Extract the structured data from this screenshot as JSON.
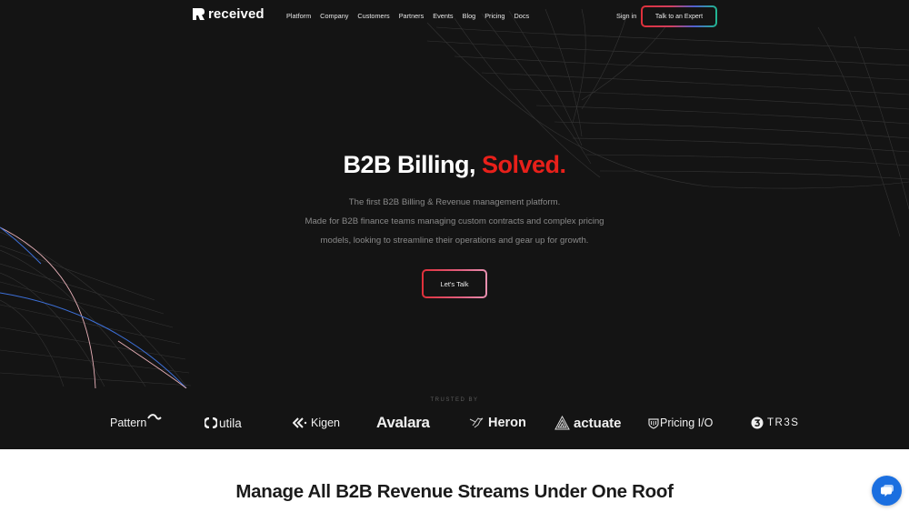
{
  "brand": {
    "name": "received",
    "logo_icon": "received-logo-icon"
  },
  "nav": {
    "links": [
      "Platform",
      "Company",
      "Customers",
      "Partners",
      "Events",
      "Blog",
      "Pricing",
      "Docs"
    ],
    "sign_in": "Sign in",
    "cta": "Talk to an Expert"
  },
  "hero": {
    "headline_main": "B2B Billing, ",
    "headline_accent": "Solved.",
    "subtitle_lines": [
      "The first B2B Billing & Revenue management platform.",
      "Made for B2B finance teams managing custom contracts and complex pricing",
      "models, looking to streamline their operations and gear up for growth."
    ],
    "cta": "Let's Talk"
  },
  "trusted": {
    "label": "TRUSTED BY",
    "logos": [
      {
        "name": "Pattern",
        "icon": "pattern-wave-icon"
      },
      {
        "name": "utila",
        "icon": "utila-ring-icon"
      },
      {
        "name": "Kigen",
        "icon": "kigen-chevrons-icon"
      },
      {
        "name": "Avalara",
        "icon": "avalara-wordmark"
      },
      {
        "name": "Heron",
        "icon": "heron-bird-icon"
      },
      {
        "name": "actuate",
        "icon": "actuate-triangle-icon"
      },
      {
        "name": "Pricing I/O",
        "icon": "pricingio-shield-icon"
      },
      {
        "name": "TR3S",
        "icon": "tres-badge-icon"
      }
    ]
  },
  "section": {
    "title": "Manage All B2B Revenue Streams Under One Roof"
  },
  "chat": {
    "icon": "chat-bubble-icon"
  },
  "colors": {
    "accent_red": "#e8201a",
    "background_dark": "#141414",
    "chat_blue": "#1b6fe0"
  }
}
